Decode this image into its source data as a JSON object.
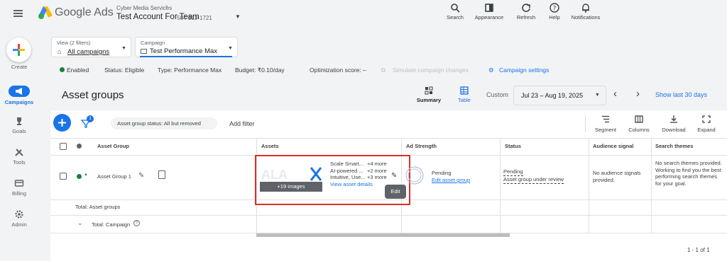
{
  "header": {
    "brand": "Google Ads",
    "account_parent": "Cyber Media Services",
    "account_name": "Test Account For Team",
    "account_id": "584-313-1721"
  },
  "toolbar": {
    "search": "Search",
    "appearance": "Appearance",
    "refresh": "Refresh",
    "help": "Help",
    "notifications": "Notifications"
  },
  "nav": {
    "create": "Create",
    "campaigns": "Campaigns",
    "goals": "Goals",
    "tools": "Tools",
    "billing": "Billing",
    "admin": "Admin"
  },
  "filters": {
    "view_label": "View (2 filters)",
    "view_value": "All campaigns",
    "campaign_label": "Campaign",
    "campaign_value": "Test Performance Max"
  },
  "status": {
    "enabled": "Enabled",
    "status": "Status: Eligible",
    "type": "Type: Performance Max",
    "budget": "Budget: ₹0.10/day",
    "opt": "Optimization score: –",
    "simulate": "Simulate campaign changes",
    "settings": "Campaign settings"
  },
  "page": {
    "title": "Asset groups",
    "summary": "Summary",
    "table": "Table",
    "custom": "Custom",
    "date_range": "Jul 23 – Aug 19, 2025",
    "show_last": "Show last 30 days"
  },
  "table_toolbar": {
    "filter_badge": "1",
    "filter_chip": "Asset group status: All but removed",
    "add_filter": "Add filter",
    "segment": "Segment",
    "columns": "Columns",
    "download": "Download",
    "expand": "Expand"
  },
  "columns": [
    "Asset Group",
    "Assets",
    "Ad Strength",
    "Status",
    "Audience signal",
    "Search themes"
  ],
  "row": {
    "name": "Asset Group 1",
    "images_badge": "+19 images",
    "asset_lines": [
      {
        "text": "Scale Smart...",
        "more": "+4 more"
      },
      {
        "text": "AI-powered ...",
        "more": "+2 more"
      },
      {
        "text": "Intuitive, Use...",
        "more": "+3 more"
      }
    ],
    "view_details": "View asset details",
    "edit_tooltip": "Edit",
    "strength": "Pending",
    "edit_asset_group": "Edit asset group",
    "status": "Pending",
    "status_detail": "Asset group under review",
    "audience": "No audience signals provided.",
    "themes": "No search themes provided. Working to find you the best performing search themes for your goal."
  },
  "totals": {
    "groups": "Total: Asset groups",
    "campaign": "Total: Campaign"
  },
  "pagination": "1 - 1 of 1",
  "colors": {
    "accent": "#1a73e8",
    "highlight": "#d93025",
    "enabled": "#188038"
  }
}
